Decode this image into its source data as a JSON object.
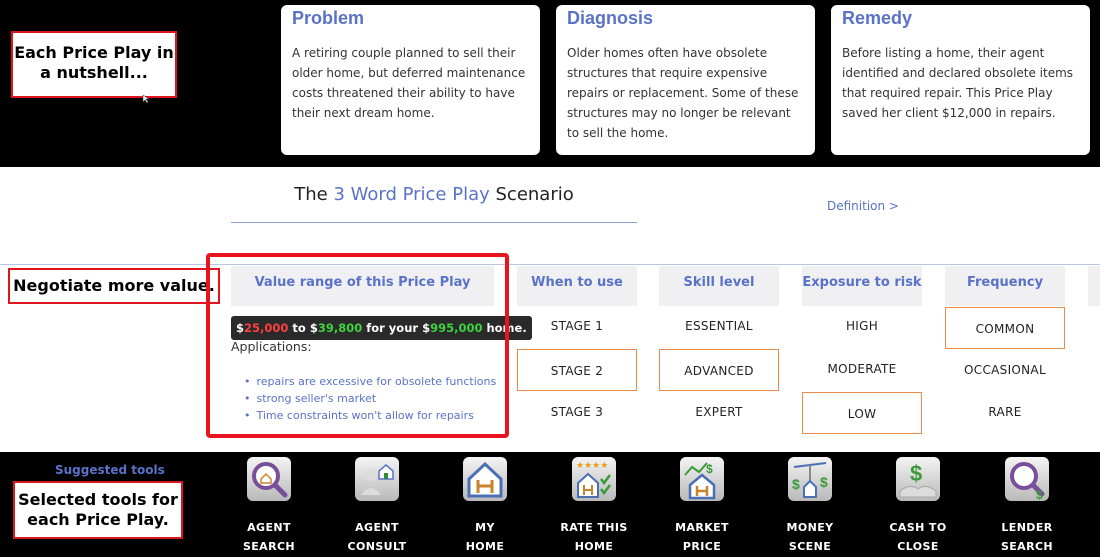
{
  "cards": [
    {
      "title": "Problem",
      "body": "A retiring couple planned to sell their older home, but deferred maintenance costs threatened their ability to have their next dream home."
    },
    {
      "title": "Diagnosis",
      "body": "Older homes often have obsolete structures that require expensive repairs or replacement. Some of these structures may no longer be relevant to sell the home."
    },
    {
      "title": "Remedy",
      "body": "Before listing a home, their agent identified and declared obsolete items that required repair. This Price Play saved her client $12,000 in repairs."
    }
  ],
  "callouts": {
    "nutshell": "Each Price Play in a nutshell...",
    "negotiate": "Negotiate more value.",
    "tools": "Selected tools for each Price Play."
  },
  "scenario": {
    "prefix": "The ",
    "accent": "3 Word Price Play",
    "suffix": " Scenario",
    "definition_link": "Definition >"
  },
  "value_range": {
    "header": "Value range of this Price Play",
    "currency": "$",
    "low": "25,000",
    "to": " to ",
    "high": "39,800",
    "for_your": " for your ",
    "home_value": "995,000",
    "home_suffix": " home.",
    "applications_label": "Applications:",
    "applications": [
      "repairs are excessive for obsolete functions",
      "strong seller's market",
      "Time constraints won't allow for repairs"
    ]
  },
  "criteria": [
    {
      "header": "When to use",
      "options": [
        "STAGE 1",
        "STAGE 2",
        "STAGE 3"
      ],
      "selected_index": 1
    },
    {
      "header": "Skill level",
      "options": [
        "ESSENTIAL",
        "ADVANCED",
        "EXPERT"
      ],
      "selected_index": 1
    },
    {
      "header": "Exposure to risk",
      "options": [
        "HIGH",
        "MODERATE",
        "LOW"
      ],
      "selected_index": 2
    },
    {
      "header": "Frequency",
      "options": [
        "COMMON",
        "OCCASIONAL",
        "RARE"
      ],
      "selected_index": 0
    }
  ],
  "suggested_tools": {
    "label": "Suggested tools",
    "tools": [
      {
        "line1": "AGENT",
        "line2": "SEARCH",
        "icon": "magnifier-house-icon"
      },
      {
        "line1": "AGENT",
        "line2": "CONSULT",
        "icon": "agent-consult-icon"
      },
      {
        "line1": "MY",
        "line2": "HOME",
        "icon": "house-icon"
      },
      {
        "line1": "RATE THIS",
        "line2": "HOME",
        "icon": "rate-home-icon"
      },
      {
        "line1": "MARKET",
        "line2": "PRICE",
        "icon": "market-price-icon"
      },
      {
        "line1": "MONEY",
        "line2": "SCENE",
        "icon": "money-scale-icon"
      },
      {
        "line1": "CASH TO",
        "line2": "CLOSE",
        "icon": "cash-close-icon"
      },
      {
        "line1": "LENDER",
        "line2": "SEARCH",
        "icon": "lender-search-icon"
      }
    ]
  },
  "colors": {
    "accent": "#5a72c8",
    "callout_border": "#e0141e",
    "selected_border": "#f08a4b",
    "value_low": "#ff4040",
    "value_high": "#3fd23f"
  }
}
